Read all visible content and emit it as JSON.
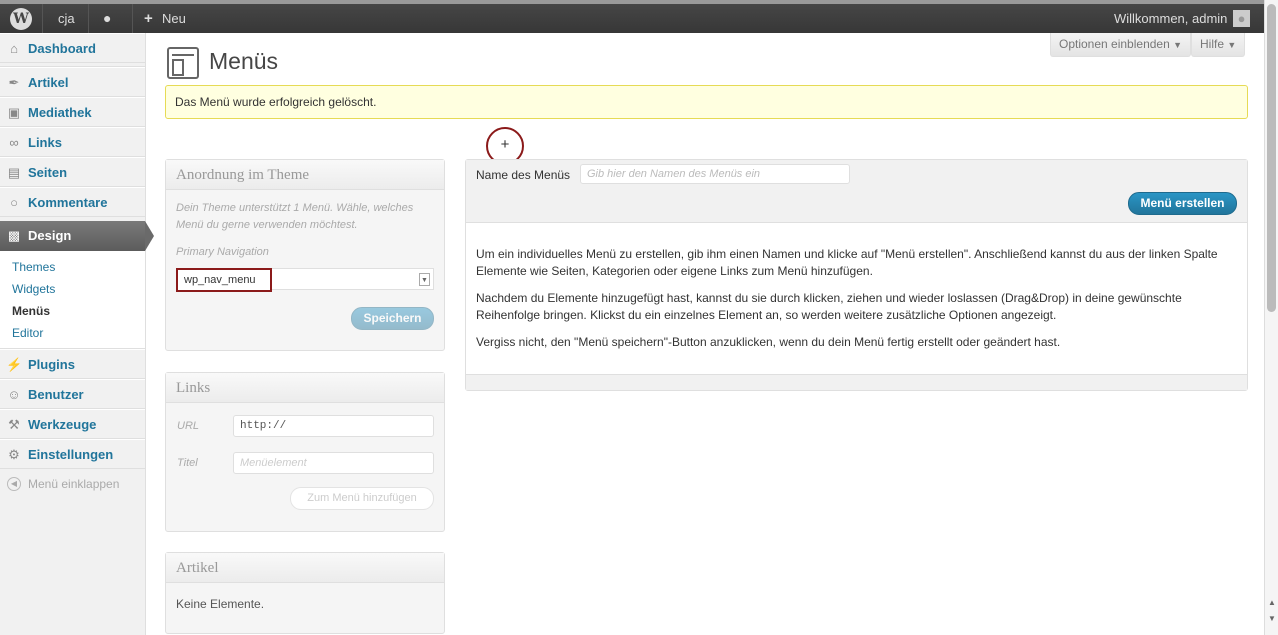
{
  "adminbar": {
    "site_name": "cja",
    "new_label": "Neu",
    "welcome": "Willkommen, admin"
  },
  "sidebar": {
    "items": [
      {
        "label": "Dashboard",
        "icon": "dashboard-icon"
      },
      {
        "label": "Artikel",
        "icon": "pin-icon"
      },
      {
        "label": "Mediathek",
        "icon": "media-icon"
      },
      {
        "label": "Links",
        "icon": "links-icon"
      },
      {
        "label": "Seiten",
        "icon": "pages-icon"
      },
      {
        "label": "Kommentare",
        "icon": "comments-icon"
      },
      {
        "label": "Design",
        "icon": "appearance-icon"
      },
      {
        "label": "Plugins",
        "icon": "plugins-icon"
      },
      {
        "label": "Benutzer",
        "icon": "users-icon"
      },
      {
        "label": "Werkzeuge",
        "icon": "tools-icon"
      },
      {
        "label": "Einstellungen",
        "icon": "settings-icon"
      }
    ],
    "design_submenu": [
      "Themes",
      "Widgets",
      "Menüs",
      "Editor"
    ],
    "collapse_label": "Menü einklappen"
  },
  "screen_options": "Optionen einblenden",
  "help": "Hilfe",
  "page_title": "Menüs",
  "notice": "Das Menü wurde erfolgreich gelöscht.",
  "theme_box": {
    "title": "Anordnung im Theme",
    "desc": "Dein Theme unterstützt 1 Menü. Wähle, welches Menü du gerne verwenden möchtest.",
    "nav_label": "Primary Navigation",
    "select_value": "wp_nav_menu",
    "save_button": "Speichern"
  },
  "links_box": {
    "title": "Links",
    "url_label": "URL",
    "url_value": "http://",
    "title_label": "Titel",
    "title_placeholder": "Menüelement",
    "add_button": "Zum Menü hinzufügen"
  },
  "articles_box": {
    "title": "Artikel",
    "empty": "Keine Elemente."
  },
  "menu_panel": {
    "name_label": "Name des Menüs",
    "name_placeholder": "Gib hier den Namen des Menüs ein",
    "create_button": "Menü erstellen",
    "help_paragraphs": [
      "Um ein individuelles Menü zu erstellen, gib ihm einen Namen und klicke auf \"Menü erstellen\". Anschließend kannst du aus der linken Spalte Elemente wie Seiten, Kategorien oder eigene Links zum Menü hinzufügen.",
      "Nachdem du Elemente hinzugefügt hast, kannst du sie durch klicken, ziehen und wieder loslassen (Drag&Drop) in deine gewünschte Reihenfolge bringen. Klickst du ein einzelnes Element an, so werden weitere zusätzliche Optionen angezeigt.",
      "Vergiss nicht, den \"Menü speichern\"-Button anzuklicken, wenn du dein Menü fertig erstellt oder geändert hast."
    ]
  },
  "plus_marker": "+"
}
